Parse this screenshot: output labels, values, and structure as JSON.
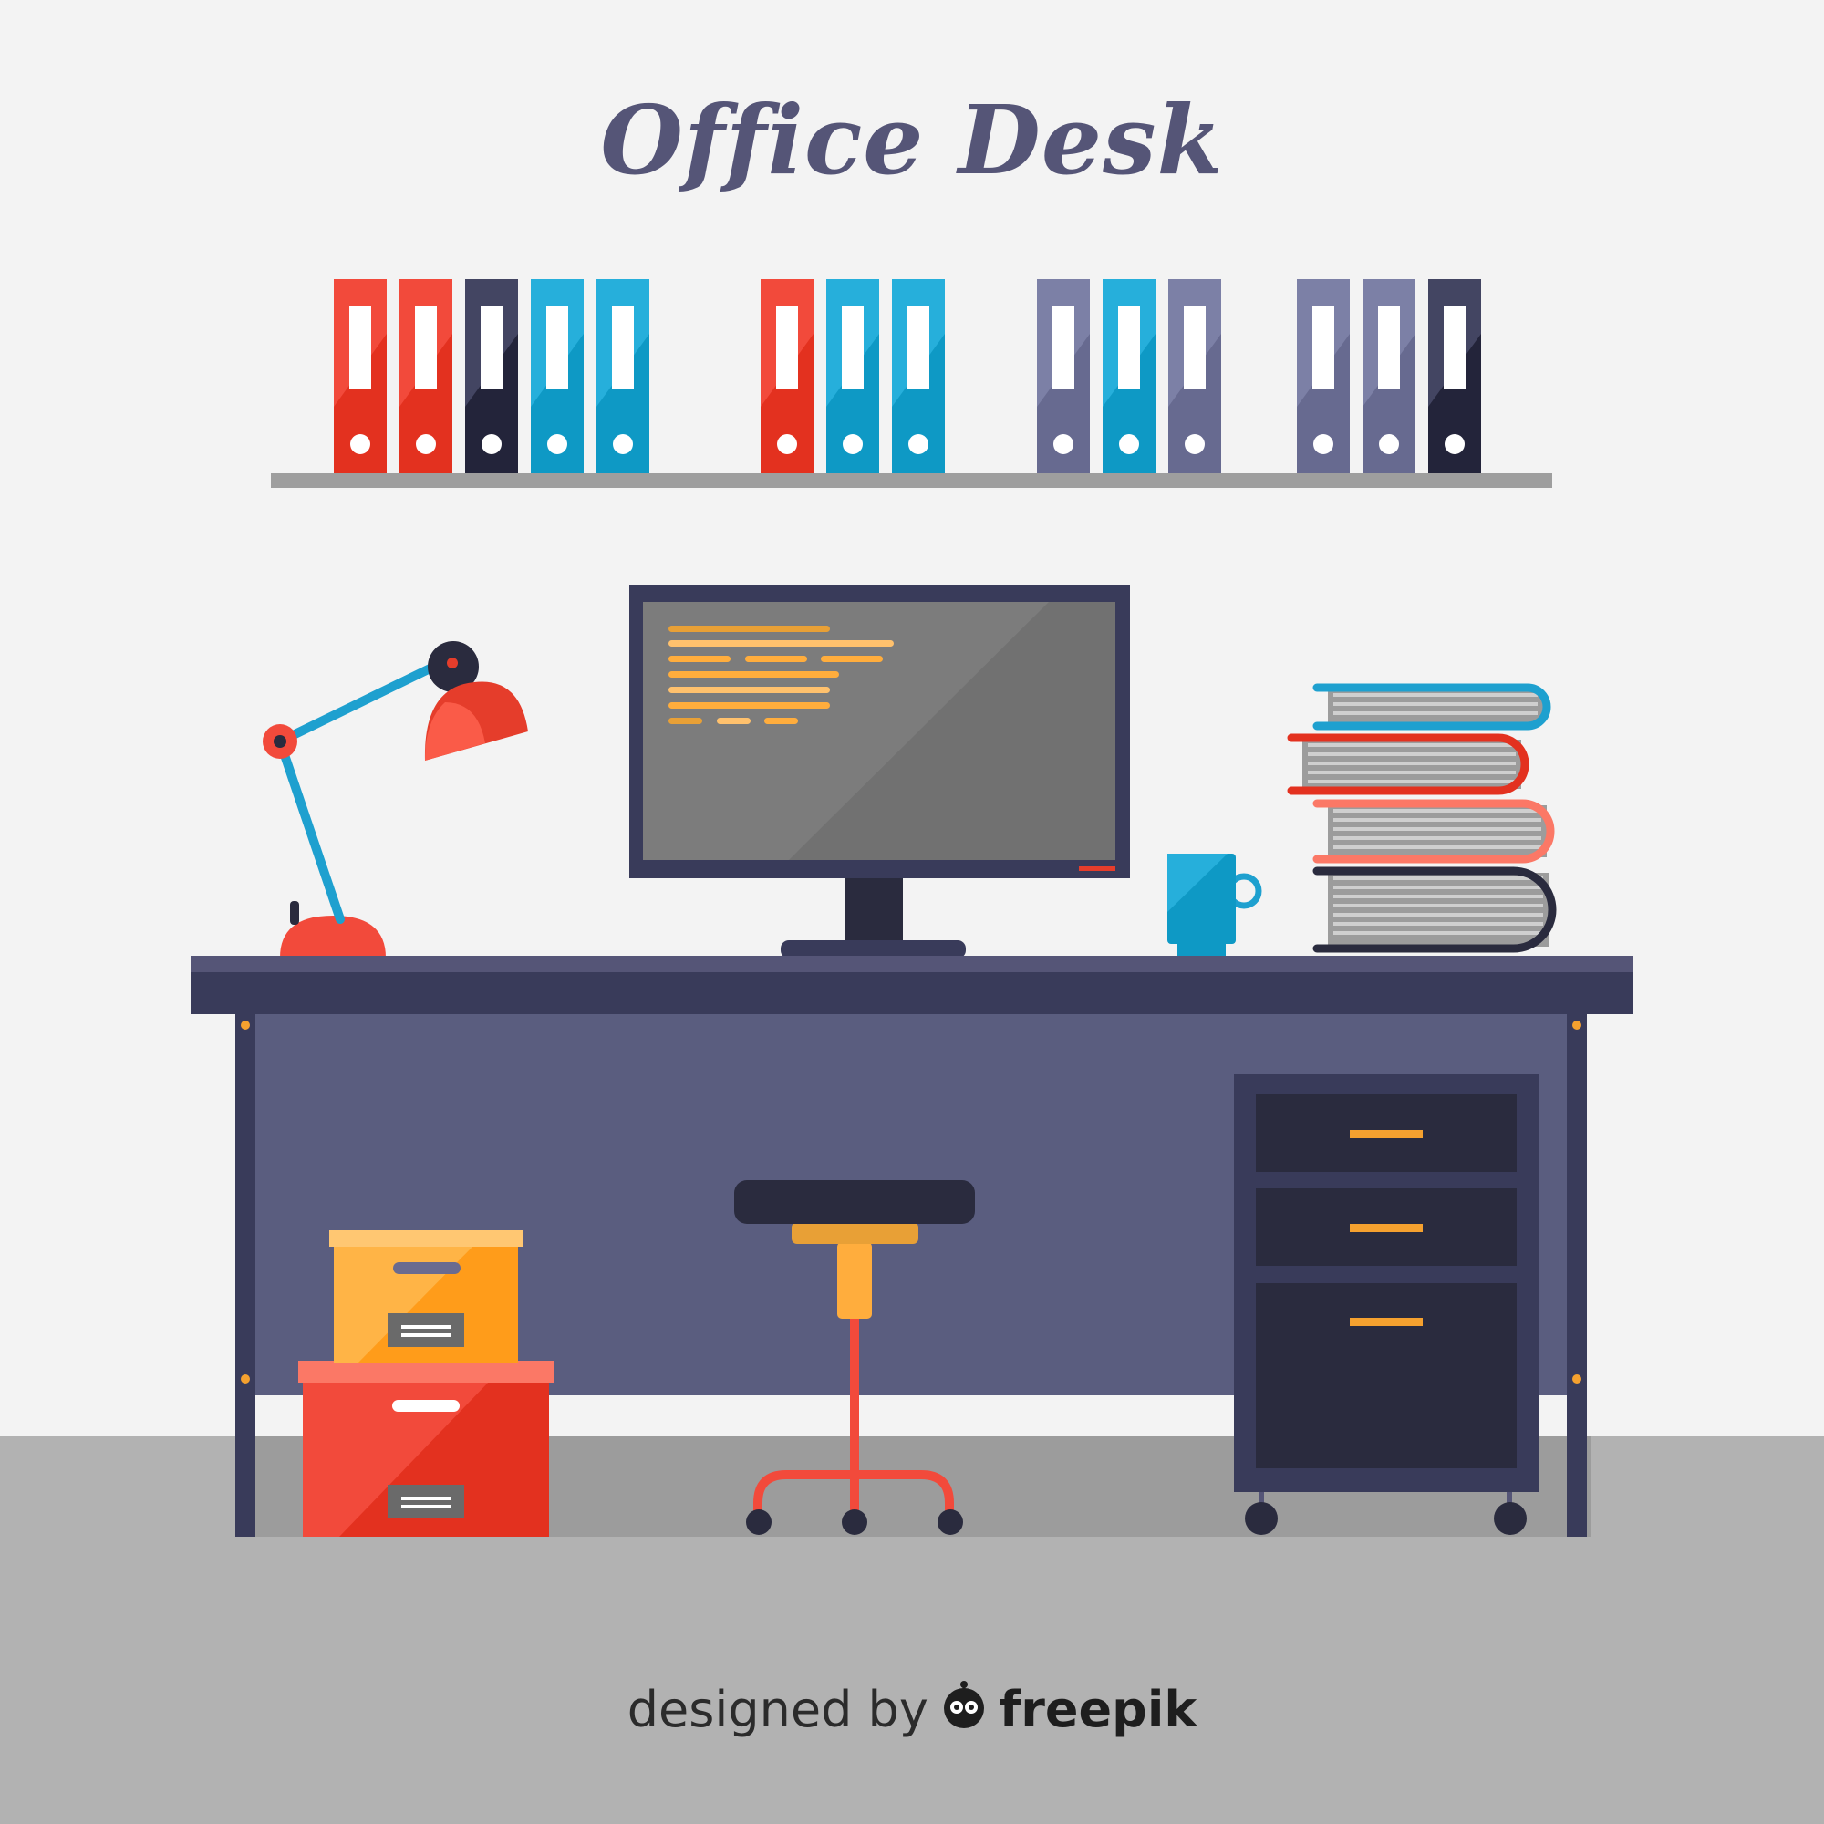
{
  "page": {
    "title": "Office Desk",
    "credit_prefix": "designed by",
    "credit_brand": "freepik"
  },
  "icons": {
    "brand_logo": "freepik-logo-icon"
  },
  "colors": {
    "wall": "#f3f3f3",
    "floor": "#b2b2b2",
    "floor_shadow": "#9c9c9c",
    "title_text": "#555577",
    "desk_top": "#555577",
    "desk_body": "#5a5d7f",
    "desk_dark": "#37385a",
    "red": "#e53d2b",
    "blue": "#0e99c5",
    "slate": "#676a90",
    "navy": "#2a2b3e",
    "orange": "#ffa42a"
  },
  "shelf": {
    "groups": [
      [
        "red",
        "red",
        "navy",
        "blue",
        "blue"
      ],
      [
        "red",
        "blue",
        "blue"
      ],
      [
        "slate",
        "blue",
        "slate"
      ],
      [
        "slate",
        "slate",
        "navy"
      ]
    ]
  }
}
